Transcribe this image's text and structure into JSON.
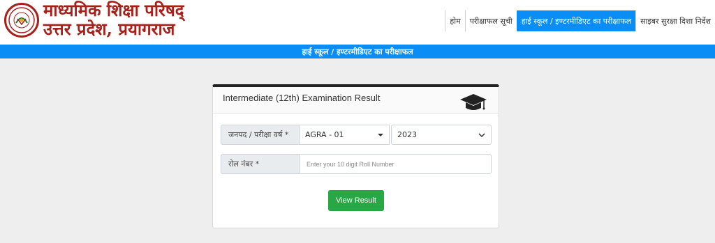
{
  "header": {
    "org_line1": "माध्यमिक शिक्षा परिषद्",
    "org_line2": "उत्तर प्रदेश, प्रयागराज",
    "logo_icon": "up-emblem-icon"
  },
  "nav": {
    "items": [
      {
        "label": "होम"
      },
      {
        "label": "परीक्षाफल सूची"
      },
      {
        "label": "हाई स्कूल / इण्टरमीडिएट का परीक्षाफल",
        "active": true
      },
      {
        "label": "साइबर सुरक्षा दिशा निर्देश"
      }
    ]
  },
  "banner": {
    "text": "हाई स्कूल / इण्टरमीडिएट का परीक्षाफल"
  },
  "form": {
    "title": "Intermediate (12th) Examination Result",
    "title_icon": "graduation-cap-icon",
    "district_label": "जनपद / परीक्षा वर्ष *",
    "district_value": "AGRA - 01",
    "year_value": "2023",
    "roll_label": "रोल नंबर *",
    "roll_placeholder": "Enter your 10 digit Roll Number",
    "submit_label": "View Result"
  },
  "colors": {
    "brand_red": "#a8201a",
    "nav_blue": "#0a8ef5",
    "button_green": "#28a745"
  }
}
